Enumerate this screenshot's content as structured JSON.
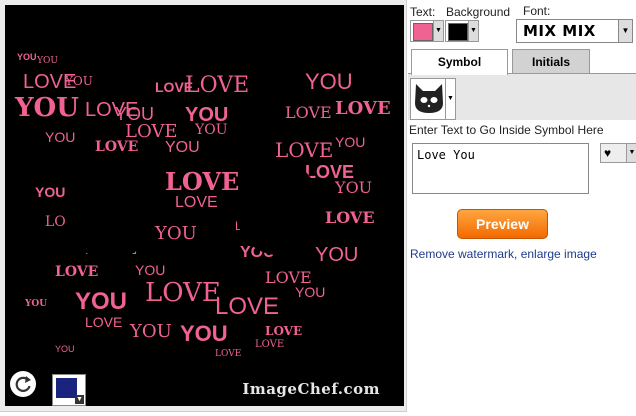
{
  "canvas": {
    "background": "#000000",
    "text_color": "#f06292",
    "words": [
      "YOU",
      "YOU",
      "LOVE",
      "YOU",
      "LOVE",
      "YOU",
      "LOVE",
      "LOVE",
      "YOU",
      "LOVE",
      "YOU",
      "LOVE",
      "YOU",
      "LOVE",
      "YOU",
      "LOVE",
      "YOU",
      "LOVE",
      "LOVE",
      "YOU",
      "YOU",
      "LOVE",
      "LOVE",
      "YOU",
      "YOU",
      "LOVE",
      "YOU",
      "LOVE",
      "LOVE",
      "YOU",
      "YOU",
      "LOVE",
      "YOU",
      "LOVE",
      "YOU",
      "LOVE",
      "YOU",
      "LOVE",
      "LOVE",
      "YOU",
      "LOVE",
      "YOU",
      "YOU",
      "LOVE",
      "YOU",
      "LOVE",
      "YOU",
      "LOVE"
    ],
    "watermark": "ImageChef.com",
    "bg_swatch_color": "#1a237e"
  },
  "panel": {
    "text_label": "Text:",
    "background_label": "Background",
    "font_label": "Font:",
    "text_color": "#f06292",
    "background_color": "#000000",
    "font_value": "MIX MIX",
    "tabs": [
      "Symbol",
      "Initials"
    ],
    "symbol_icon": "cat-face-icon",
    "hint": "Enter Text to Go Inside Symbol Here",
    "text_value": "Love You",
    "heart_icon": "heart-icon",
    "preview_label": "Preview",
    "watermark_link": "Remove watermark, enlarge image"
  }
}
